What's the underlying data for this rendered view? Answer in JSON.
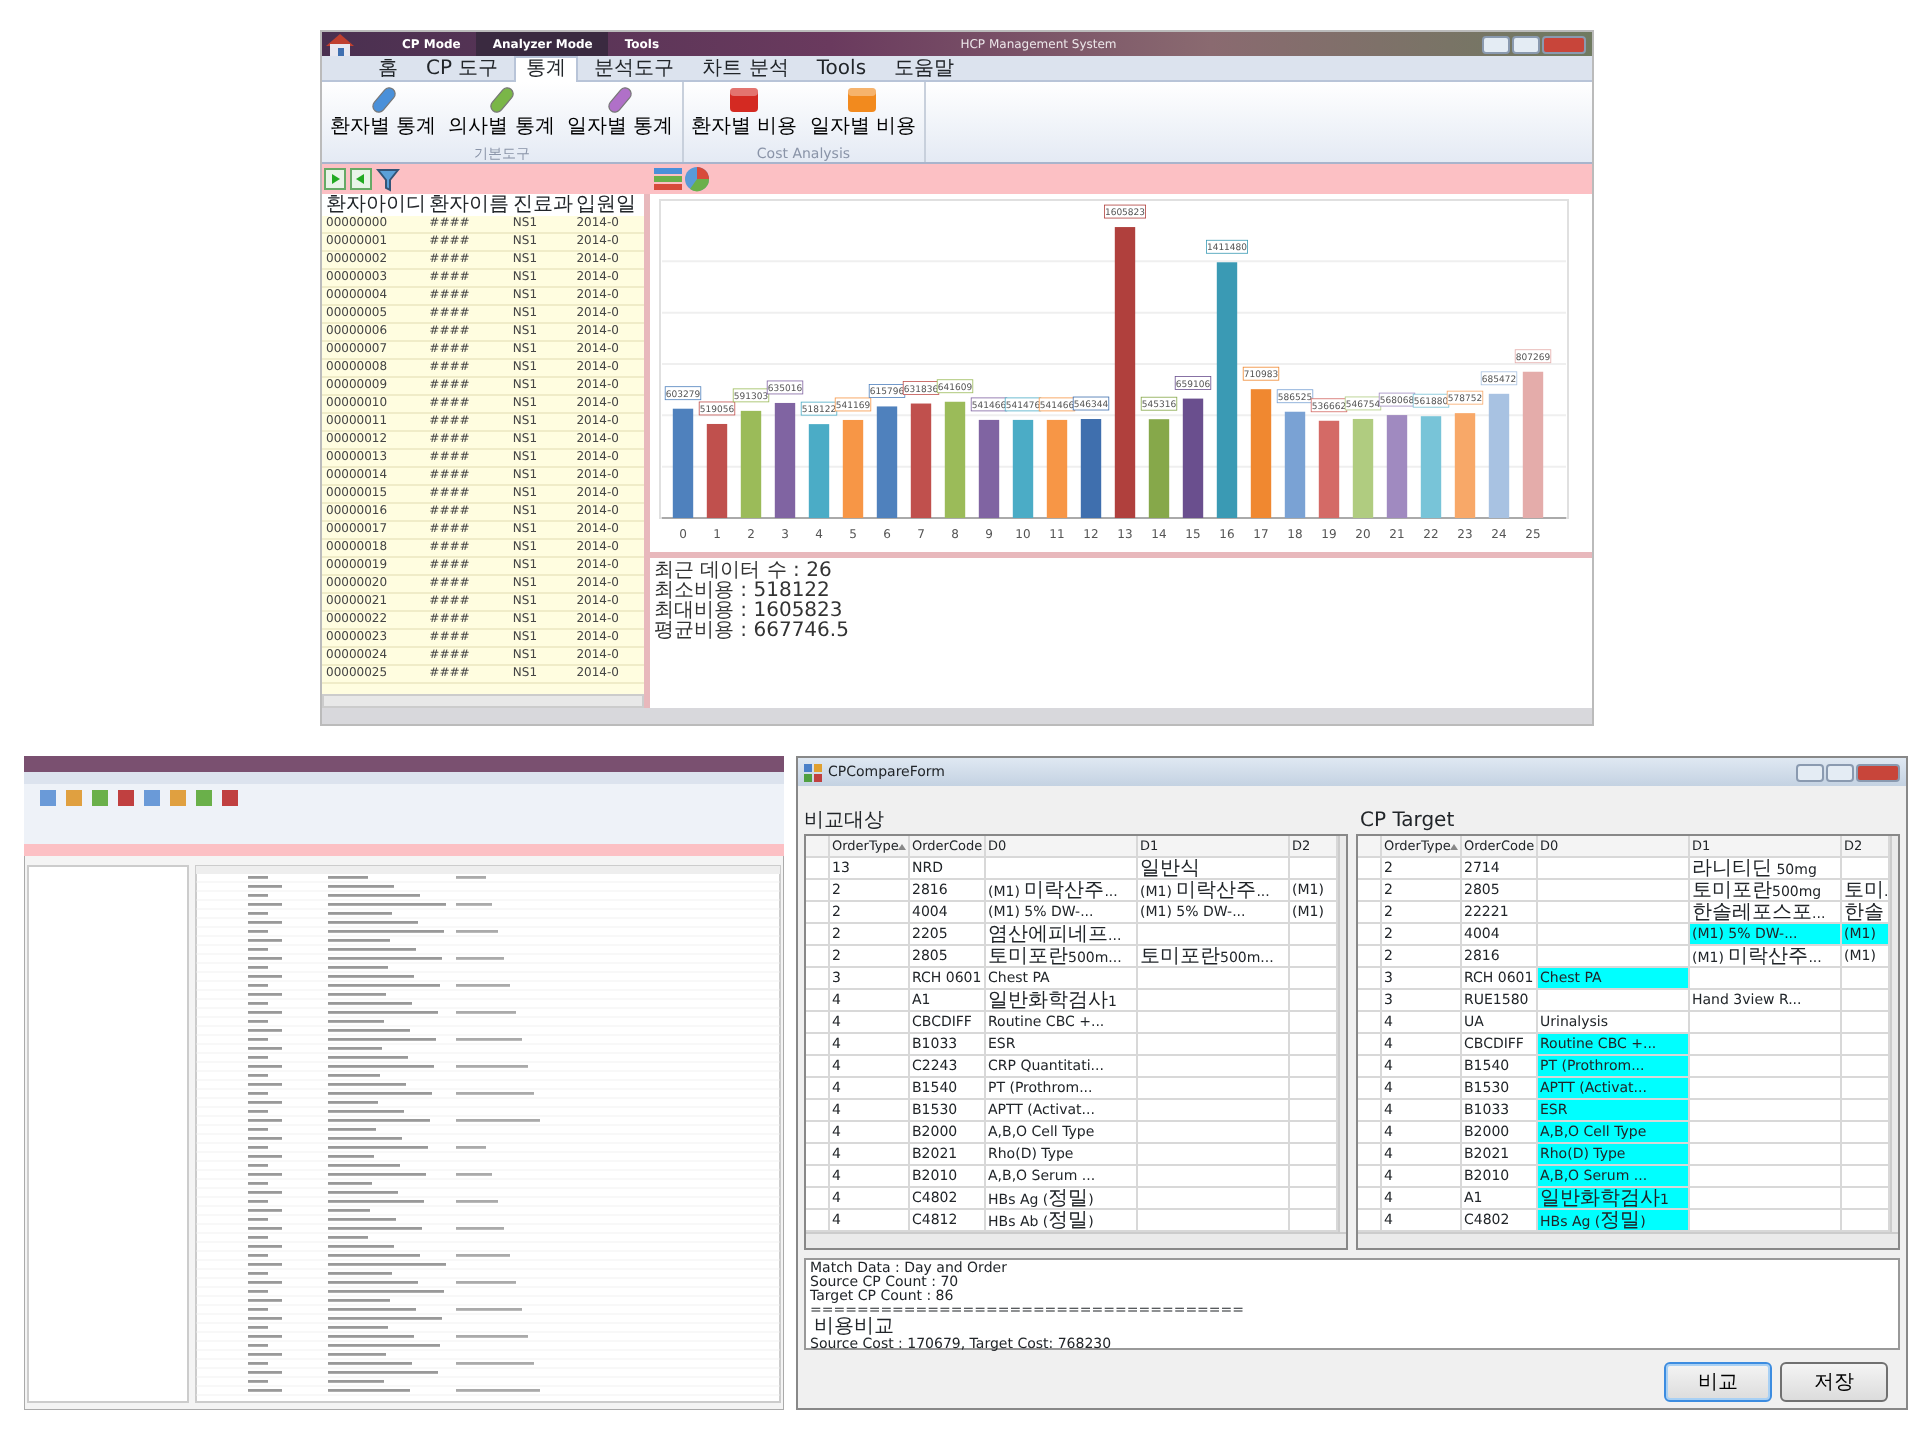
{
  "main_window": {
    "title": "HCP Management System",
    "mode_tabs": [
      {
        "label": "CP Mode",
        "selected": false
      },
      {
        "label": "Analyzer Mode",
        "selected": true
      },
      {
        "label": "Tools",
        "selected": false
      }
    ],
    "ribbon_tabs": [
      {
        "label": "홈",
        "selected": false
      },
      {
        "label": "CP 도구",
        "selected": false
      },
      {
        "label": "통계",
        "selected": true
      },
      {
        "label": "분석도구",
        "selected": false
      },
      {
        "label": "차트 분석",
        "selected": false
      },
      {
        "label": "Tools",
        "selected": false
      },
      {
        "label": "도움말",
        "selected": false
      }
    ],
    "ribbon_groups": [
      {
        "label": "기본도구",
        "buttons": [
          {
            "label": "환자별 통계",
            "kind": "capsule",
            "color": "#4a90d9"
          },
          {
            "label": "의사별 통계",
            "kind": "capsule",
            "color": "#7ab648"
          },
          {
            "label": "일자별 통계",
            "kind": "capsule",
            "color": "#b070c8"
          }
        ]
      },
      {
        "label": "Cost Analysis",
        "buttons": [
          {
            "label": "환자별 비용",
            "kind": "block",
            "color": "#d42a22"
          },
          {
            "label": "일자별 비용",
            "kind": "block",
            "color": "#f28a1e"
          }
        ]
      }
    ],
    "patient_grid": {
      "columns": [
        "환자아이디",
        "환자이름",
        "진료과",
        "입원일"
      ],
      "rows": [
        [
          "00000000",
          "####",
          "NS1",
          "2014-0"
        ],
        [
          "00000001",
          "####",
          "NS1",
          "2014-0"
        ],
        [
          "00000002",
          "####",
          "NS1",
          "2014-0"
        ],
        [
          "00000003",
          "####",
          "NS1",
          "2014-0"
        ],
        [
          "00000004",
          "####",
          "NS1",
          "2014-0"
        ],
        [
          "00000005",
          "####",
          "NS1",
          "2014-0"
        ],
        [
          "00000006",
          "####",
          "NS1",
          "2014-0"
        ],
        [
          "00000007",
          "####",
          "NS1",
          "2014-0"
        ],
        [
          "00000008",
          "####",
          "NS1",
          "2014-0"
        ],
        [
          "00000009",
          "####",
          "NS1",
          "2014-0"
        ],
        [
          "00000010",
          "####",
          "NS1",
          "2014-0"
        ],
        [
          "00000011",
          "####",
          "NS1",
          "2014-0"
        ],
        [
          "00000012",
          "####",
          "NS1",
          "2014-0"
        ],
        [
          "00000013",
          "####",
          "NS1",
          "2014-0"
        ],
        [
          "00000014",
          "####",
          "NS1",
          "2014-0"
        ],
        [
          "00000015",
          "####",
          "NS1",
          "2014-0"
        ],
        [
          "00000016",
          "####",
          "NS1",
          "2014-0"
        ],
        [
          "00000017",
          "####",
          "NS1",
          "2014-0"
        ],
        [
          "00000018",
          "####",
          "NS1",
          "2014-0"
        ],
        [
          "00000019",
          "####",
          "NS1",
          "2014-0"
        ],
        [
          "00000020",
          "####",
          "NS1",
          "2014-0"
        ],
        [
          "00000021",
          "####",
          "NS1",
          "2014-0"
        ],
        [
          "00000022",
          "####",
          "NS1",
          "2014-0"
        ],
        [
          "00000023",
          "####",
          "NS1",
          "2014-0"
        ],
        [
          "00000024",
          "####",
          "NS1",
          "2014-0"
        ],
        [
          "00000025",
          "####",
          "NS1",
          "2014-0"
        ]
      ]
    },
    "chart": {
      "chart_data": {
        "type": "bar",
        "categories": [
          "0",
          "1",
          "2",
          "3",
          "4",
          "5",
          "6",
          "7",
          "8",
          "9",
          "10",
          "11",
          "12",
          "13",
          "14",
          "15",
          "16",
          "17",
          "18",
          "19",
          "20",
          "21",
          "22",
          "23",
          "24",
          "25"
        ],
        "series": [
          {
            "values": [
              603279,
              519056,
              591303,
              635016,
              518122,
              541169,
              615796,
              631836,
              641609,
              541466,
              541476,
              541466,
              546344,
              1605823,
              545316,
              659106,
              1411480,
              710983,
              586525,
              536662,
              546754,
              568068,
              561880,
              578752,
              685472,
              807269
            ]
          }
        ],
        "colors": [
          "#4f81bd",
          "#c0504d",
          "#9bbb59",
          "#8064a2",
          "#4bacc6",
          "#f79646",
          "#4f81bd",
          "#c0504d",
          "#9bbb59",
          "#8064a2",
          "#4bacc6",
          "#f79646",
          "#3f6fae",
          "#b0403d",
          "#86a84a",
          "#6a4f8e",
          "#3a9ab4",
          "#f08830",
          "#7aa2d4",
          "#d46a66",
          "#b0cc80",
          "#a08ac0",
          "#78c4d8",
          "#f8a868",
          "#a8c2e2",
          "#e4acaa"
        ],
        "ylim": [
          0,
          1700000
        ],
        "data_labels": true
      },
      "stats": [
        "최근 데이터 수 : 26",
        "최소비용 : 518122",
        "최대비용 : 1605823",
        "평균비용 : 667746.5"
      ]
    }
  },
  "compare_window": {
    "title": "CPCompareForm",
    "source_label": "비교대상",
    "target_label": "CP Target",
    "source_columns": [
      "OrderType",
      "OrderCode",
      "D0",
      "D1",
      "D2"
    ],
    "target_columns": [
      "OrderType",
      "OrderCode",
      "D0",
      "D1",
      "D2"
    ],
    "source_rows": [
      [
        "13",
        "NRD",
        null,
        "일반식",
        null
      ],
      [
        "2",
        "2816",
        "(M1) 미락산주...",
        "(M1) 미락산주...",
        "(M1)"
      ],
      [
        "2",
        "4004",
        "(M1) 5% DW-...",
        "(M1) 5% DW-...",
        "(M1)"
      ],
      [
        "2",
        "2205",
        "염산에피네프...",
        null,
        null
      ],
      [
        "2",
        "2805",
        "토미포란500m...",
        "토미포란500m...",
        null
      ],
      [
        "3",
        "RCH 0601",
        "Chest PA",
        null,
        null
      ],
      [
        "4",
        "A1",
        "일반화학검사1",
        null,
        null
      ],
      [
        "4",
        "CBCDIFF",
        "Routine CBC +...",
        null,
        null
      ],
      [
        "4",
        "B1033",
        "ESR",
        null,
        null
      ],
      [
        "4",
        "C2243",
        "CRP Quantitati...",
        null,
        null
      ],
      [
        "4",
        "B1540",
        "PT (Prothrom...",
        null,
        null
      ],
      [
        "4",
        "B1530",
        "APTT (Activat...",
        null,
        null
      ],
      [
        "4",
        "B2000",
        "A,B,O Cell Type",
        null,
        null
      ],
      [
        "4",
        "B2021",
        "Rho(D) Type",
        null,
        null
      ],
      [
        "4",
        "B2010",
        "A,B,O Serum ...",
        null,
        null
      ],
      [
        "4",
        "C4802",
        "HBs Ag (정밀)",
        null,
        null
      ],
      [
        "4",
        "C4812",
        "HBs Ab (정밀)",
        null,
        null
      ]
    ],
    "target_rows": [
      [
        {
          "text": "2",
          "highlighted": false
        },
        {
          "text": "2714",
          "highlighted": false
        },
        null,
        {
          "text": "라니티딘 50mg",
          "highlighted": false
        },
        null
      ],
      [
        {
          "text": "2",
          "highlighted": false
        },
        {
          "text": "2805",
          "highlighted": false
        },
        null,
        {
          "text": "토미포란500mg",
          "highlighted": false
        },
        {
          "text": "토미.",
          "highlighted": false
        }
      ],
      [
        {
          "text": "2",
          "highlighted": false
        },
        {
          "text": "22221",
          "highlighted": false
        },
        null,
        {
          "text": "한솔레포스포...",
          "highlighted": false
        },
        {
          "text": "한솔",
          "highlighted": false
        }
      ],
      [
        {
          "text": "2",
          "highlighted": false
        },
        {
          "text": "4004",
          "highlighted": false
        },
        null,
        {
          "text": "(M1) 5% DW-...",
          "highlighted": true
        },
        {
          "text": "(M1)",
          "highlighted": true
        }
      ],
      [
        {
          "text": "2",
          "highlighted": false
        },
        {
          "text": "2816",
          "highlighted": false
        },
        null,
        {
          "text": "(M1) 미락산주...",
          "highlighted": false
        },
        {
          "text": "(M1)",
          "highlighted": false
        }
      ],
      [
        {
          "text": "3",
          "highlighted": false
        },
        {
          "text": "RCH 0601",
          "highlighted": false
        },
        {
          "text": "Chest PA",
          "highlighted": true
        },
        null,
        null
      ],
      [
        {
          "text": "3",
          "highlighted": false
        },
        {
          "text": "RUE1580",
          "highlighted": false
        },
        null,
        {
          "text": "Hand 3view R...",
          "highlighted": false
        },
        null
      ],
      [
        {
          "text": "4",
          "highlighted": false
        },
        {
          "text": "UA",
          "highlighted": false
        },
        {
          "text": "Urinalysis",
          "highlighted": false
        },
        null,
        null
      ],
      [
        {
          "text": "4",
          "highlighted": false
        },
        {
          "text": "CBCDIFF",
          "highlighted": false
        },
        {
          "text": "Routine CBC +...",
          "highlighted": true
        },
        null,
        null
      ],
      [
        {
          "text": "4",
          "highlighted": false
        },
        {
          "text": "B1540",
          "highlighted": false
        },
        {
          "text": "PT (Prothrom...",
          "highlighted": true
        },
        null,
        null
      ],
      [
        {
          "text": "4",
          "highlighted": false
        },
        {
          "text": "B1530",
          "highlighted": false
        },
        {
          "text": "APTT (Activat...",
          "highlighted": true
        },
        null,
        null
      ],
      [
        {
          "text": "4",
          "highlighted": false
        },
        {
          "text": "B1033",
          "highlighted": false
        },
        {
          "text": "ESR",
          "highlighted": true
        },
        null,
        null
      ],
      [
        {
          "text": "4",
          "highlighted": false
        },
        {
          "text": "B2000",
          "highlighted": false
        },
        {
          "text": "A,B,O Cell Type",
          "highlighted": true
        },
        null,
        null
      ],
      [
        {
          "text": "4",
          "highlighted": false
        },
        {
          "text": "B2021",
          "highlighted": false
        },
        {
          "text": "Rho(D) Type",
          "highlighted": true
        },
        null,
        null
      ],
      [
        {
          "text": "4",
          "highlighted": false
        },
        {
          "text": "B2010",
          "highlighted": false
        },
        {
          "text": "A,B,O Serum ...",
          "highlighted": true
        },
        null,
        null
      ],
      [
        {
          "text": "4",
          "highlighted": false
        },
        {
          "text": "A1",
          "highlighted": false
        },
        {
          "text": "일반화학검사1",
          "highlighted": true
        },
        null,
        null
      ],
      [
        {
          "text": "4",
          "highlighted": false
        },
        {
          "text": "C4802",
          "highlighted": false
        },
        {
          "text": "HBs Ag (정밀)",
          "highlighted": true
        },
        null,
        null
      ]
    ],
    "log": [
      "Match Data : Day and Order",
      "Source CP Count : 70",
      "Target CP Count : 86",
      "=====================================",
      "비용비교",
      "Source Cost : 170679, Target Cost: 768230"
    ],
    "buttons": [
      {
        "label": "비교",
        "selected": true
      },
      {
        "label": "저장",
        "selected": false
      }
    ]
  }
}
